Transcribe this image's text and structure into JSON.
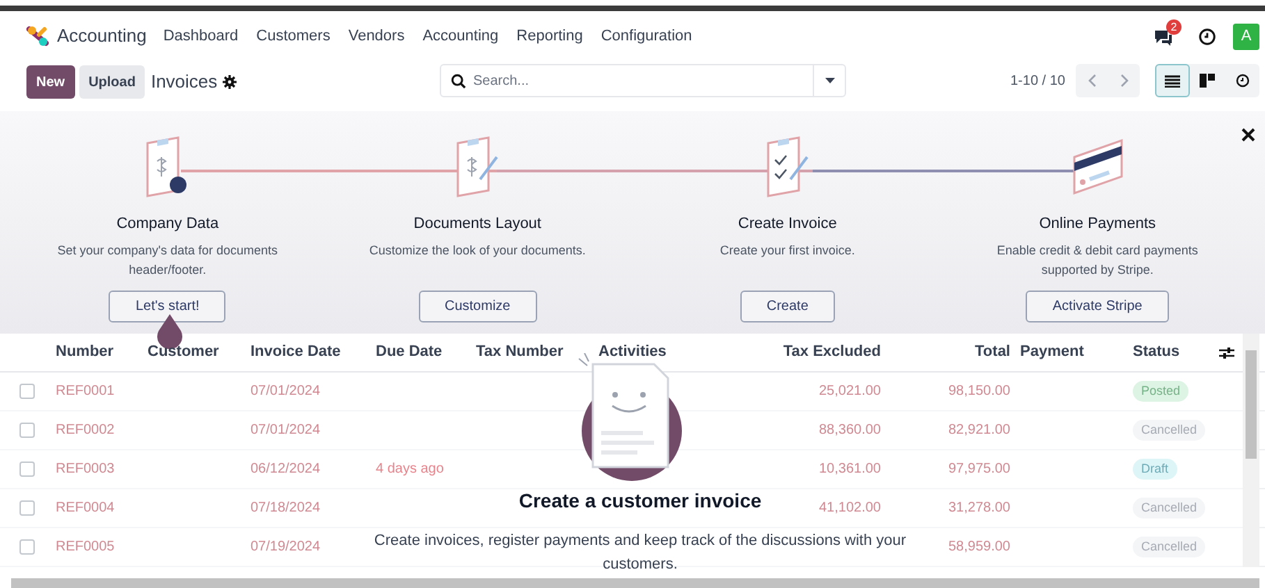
{
  "app": {
    "name": "Accounting"
  },
  "menu": [
    "Dashboard",
    "Customers",
    "Vendors",
    "Accounting",
    "Reporting",
    "Configuration"
  ],
  "systray": {
    "message_count": "2",
    "avatar": "A"
  },
  "control_panel": {
    "buttons": [
      {
        "label": "New",
        "kind": "primary"
      },
      {
        "label": "Upload",
        "kind": "secondary"
      }
    ],
    "title": "Invoices",
    "search": {
      "placeholder": "Search..."
    },
    "pager": "1-10 / 10",
    "views": [
      {
        "kind": "list",
        "selected": true
      },
      {
        "kind": "kanban",
        "selected": false
      },
      {
        "kind": "activity",
        "selected": false
      }
    ]
  },
  "onboarding": {
    "steps": [
      {
        "kind": "company",
        "title": "Company Data",
        "description": "Set your company's data for documents header/footer.",
        "button": "Let's start!"
      },
      {
        "kind": "layout",
        "title": "Documents Layout",
        "description": "Customize the look of your documents.",
        "button": "Customize"
      },
      {
        "kind": "invoice",
        "title": "Create Invoice",
        "description": "Create your first invoice.",
        "button": "Create"
      },
      {
        "kind": "payment",
        "title": "Online Payments",
        "description": "Enable credit & debit card payments supported by Stripe.",
        "button": "Activate Stripe"
      }
    ]
  },
  "table": {
    "columns": [
      "Number",
      "Customer",
      "Invoice Date",
      "Due Date",
      "Tax Number",
      "Activities",
      "Tax Excluded",
      "Total",
      "Payment",
      "Status"
    ],
    "rows": [
      {
        "selected": false,
        "number": "REF0001",
        "invoice_date": "07/01/2024",
        "tax_excluded": "25,021.00",
        "total": "98,150.00",
        "status": {
          "label": "Posted",
          "kind": "posted"
        }
      },
      {
        "selected": false,
        "number": "REF0002",
        "invoice_date": "07/01/2024",
        "tax_excluded": "88,360.00",
        "total": "82,921.00",
        "status": {
          "label": "Cancelled",
          "kind": "cancelled"
        }
      },
      {
        "selected": false,
        "number": "REF0003",
        "invoice_date": "06/12/2024",
        "due_date": "4 days ago",
        "tax_excluded": "10,361.00",
        "total": "97,975.00",
        "status": {
          "label": "Draft",
          "kind": "draft"
        }
      },
      {
        "selected": false,
        "number": "REF0004",
        "invoice_date": "07/18/2024",
        "tax_excluded": "41,102.00",
        "total": "31,278.00",
        "status": {
          "label": "Cancelled",
          "kind": "cancelled"
        }
      },
      {
        "selected": false,
        "number": "REF0005",
        "invoice_date": "07/19/2024",
        "total": "58,959.00",
        "status": {
          "label": "Cancelled",
          "kind": "cancelled"
        }
      }
    ]
  },
  "empty_state": {
    "title": "Create a customer invoice",
    "text": "Create invoices, register payments and keep track of the discussions with your customers."
  }
}
